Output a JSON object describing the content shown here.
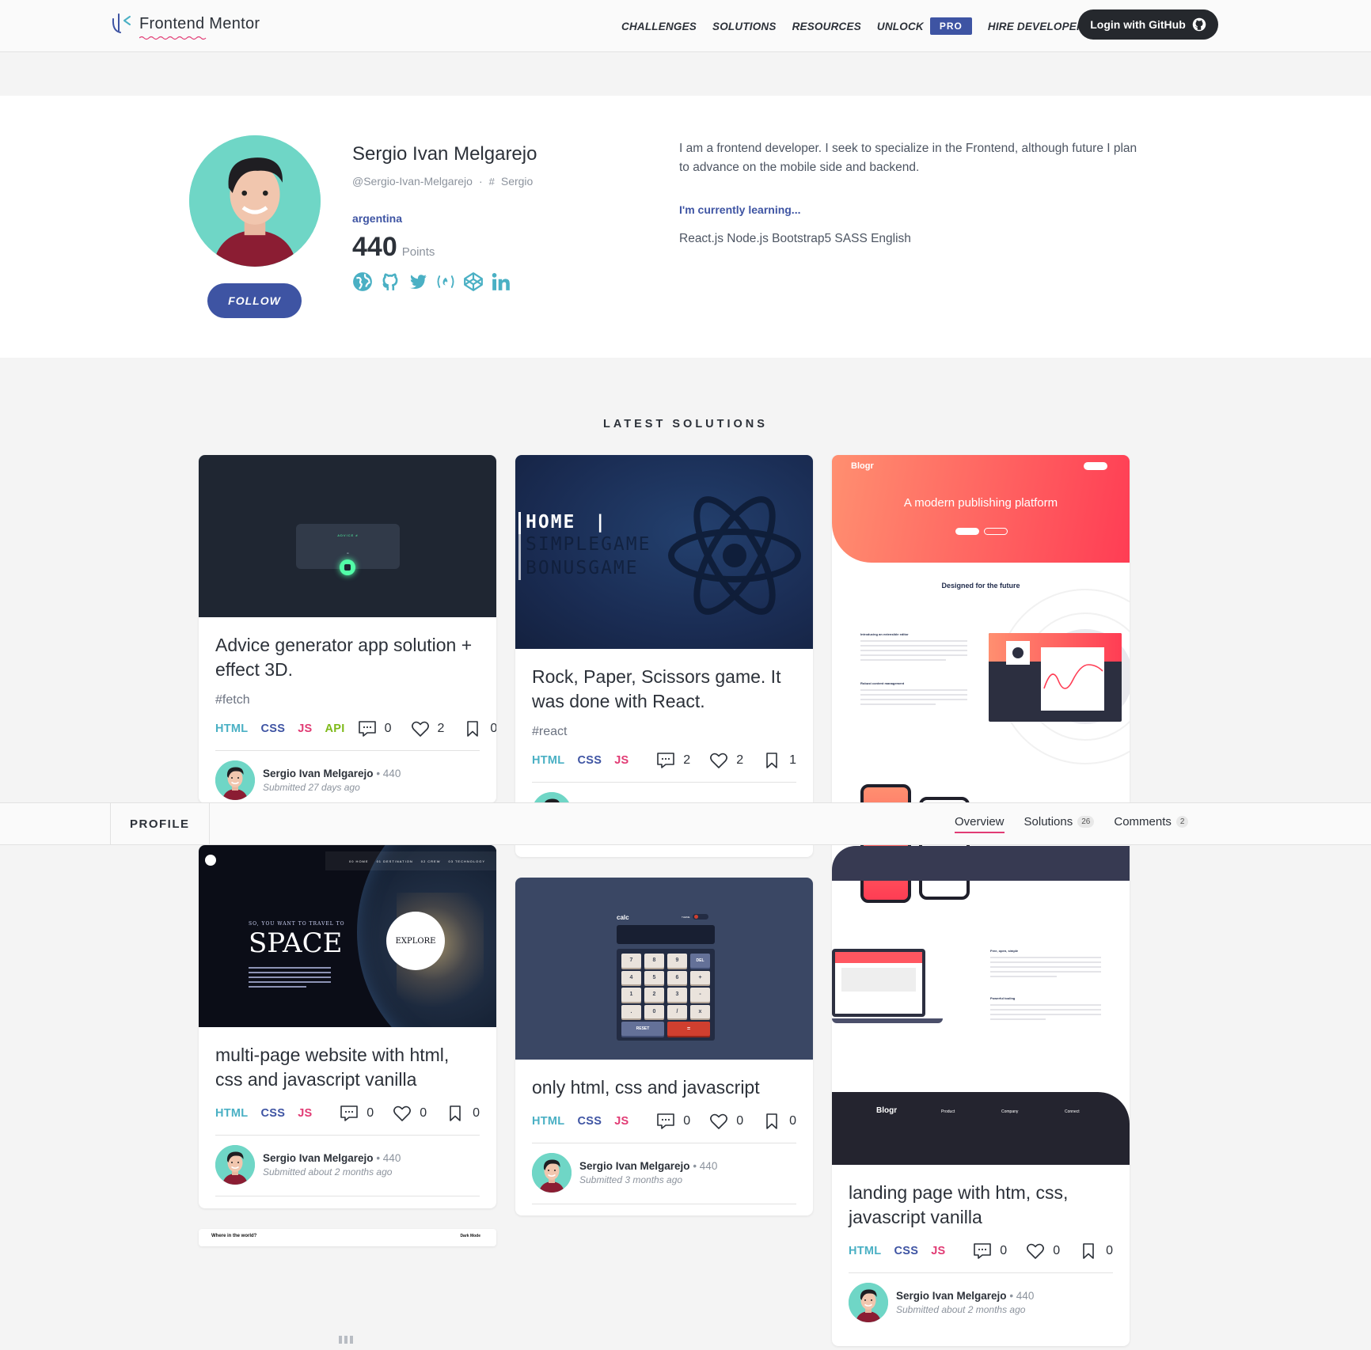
{
  "nav": {
    "logo_text": "Frontend Mentor",
    "links": [
      "CHALLENGES",
      "SOLUTIONS",
      "RESOURCES",
      "UNLOCK"
    ],
    "pro_label": "PRO",
    "hire_label": "HIRE DEVELOPERS",
    "login_label": "Login with GitHub"
  },
  "profile": {
    "name": "Sergio Ivan Melgarejo",
    "handle": "@Sergio-Ivan-Melgarejo",
    "slack_name": "Sergio",
    "country": "argentina",
    "points": "440",
    "points_label": "Points",
    "follow_label": "FOLLOW",
    "bio": "I am a frontend developer. I seek to specialize in the Frontend, although future I plan to advance on the mobile side and backend.",
    "learning_title": "I'm currently learning...",
    "learning": "React.js Node.js Bootstrap5 SASS English",
    "socials": [
      "globe-icon",
      "github-icon",
      "twitter-icon",
      "freecodecamp-icon",
      "codepen-icon",
      "linkedin-icon"
    ]
  },
  "section_title": "LATEST SOLUTIONS",
  "tabbar": {
    "title": "PROFILE",
    "tabs": [
      {
        "label": "Overview",
        "count": ""
      },
      {
        "label": "Solutions",
        "count": "26"
      },
      {
        "label": "Comments",
        "count": "2"
      }
    ]
  },
  "cards": [
    {
      "title": "Advice generator app solution + effect 3D.",
      "tag": "#fetch",
      "techs": [
        "HTML",
        "CSS",
        "JS",
        "API"
      ],
      "comments": "0",
      "likes": "2",
      "bookmarks": "0",
      "author": "Sergio Ivan Melgarejo",
      "author_points": "440",
      "submitted": "Submitted 27 days ago",
      "thumb_text": "ADVICE # ",
      "thumb_quote": "\""
    },
    {
      "title": "Rock, Paper, Scissors game. It was done with React.",
      "tag": "#react",
      "techs": [
        "HTML",
        "CSS",
        "JS"
      ],
      "comments": "2",
      "likes": "2",
      "bookmarks": "1",
      "thumb_lines": [
        "HOME",
        "SIMPLEGAME",
        "BONUSGAME"
      ]
    },
    {
      "title": "landing page with htm, css, javascript vanilla",
      "techs": [
        "HTML",
        "CSS",
        "JS"
      ],
      "comments": "0",
      "likes": "0",
      "bookmarks": "0",
      "author": "Sergio Ivan Melgarejo",
      "author_points": "440",
      "submitted": "Submitted about 2 months ago",
      "thumb_brand": "Blogr",
      "thumb_hero": "A modern publishing platform",
      "thumb_sub": "Designed for the future",
      "thumb_footer_cols": [
        "Product",
        "Company",
        "Connect"
      ],
      "thumb_heading1": "Introducing an extensible editor",
      "thumb_heading2": "Robust content management",
      "thumb_heading3": "Free, open, simple",
      "thumb_heading4": "Powerful tooling"
    },
    {
      "title": "multi-page website with html, css and javascript vanilla",
      "techs": [
        "HTML",
        "CSS",
        "JS"
      ],
      "comments": "0",
      "likes": "0",
      "bookmarks": "0",
      "author": "Sergio Ivan Melgarejo",
      "author_points": "440",
      "submitted": "Submitted about 2 months ago",
      "thumb_kicker": "SO, YOU WANT TO TRAVEL TO",
      "thumb_big": "SPACE",
      "thumb_btn": "EXPLORE",
      "thumb_menu": [
        "00 HOME",
        "01 DESTINATION",
        "02 CREW",
        "03 TECHNOLOGY"
      ]
    },
    {
      "title": "only html, css and javascript",
      "techs": [
        "HTML",
        "CSS",
        "JS"
      ],
      "comments": "0",
      "likes": "0",
      "bookmarks": "0",
      "author": "Sergio Ivan Melgarejo",
      "author_points": "440",
      "submitted": "Submitted 3 months ago",
      "thumb_calc": "calc",
      "thumb_theme": "THEME",
      "thumb_keys": [
        "7",
        "8",
        "9",
        "DEL",
        "4",
        "5",
        "6",
        "+",
        "1",
        "2",
        "3",
        "-",
        ".",
        "0",
        "/",
        "x"
      ],
      "thumb_reset": "RESET",
      "thumb_eq": "="
    },
    {
      "thumb_left": "Where in the world?",
      "thumb_right": "Dark Mode"
    }
  ],
  "colors": {
    "accent_blue": "#3e54a3",
    "accent_cyan": "#4ab0c4",
    "accent_pink": "#e13b74",
    "accent_green": "#7eba19",
    "dark": "#25282d"
  }
}
